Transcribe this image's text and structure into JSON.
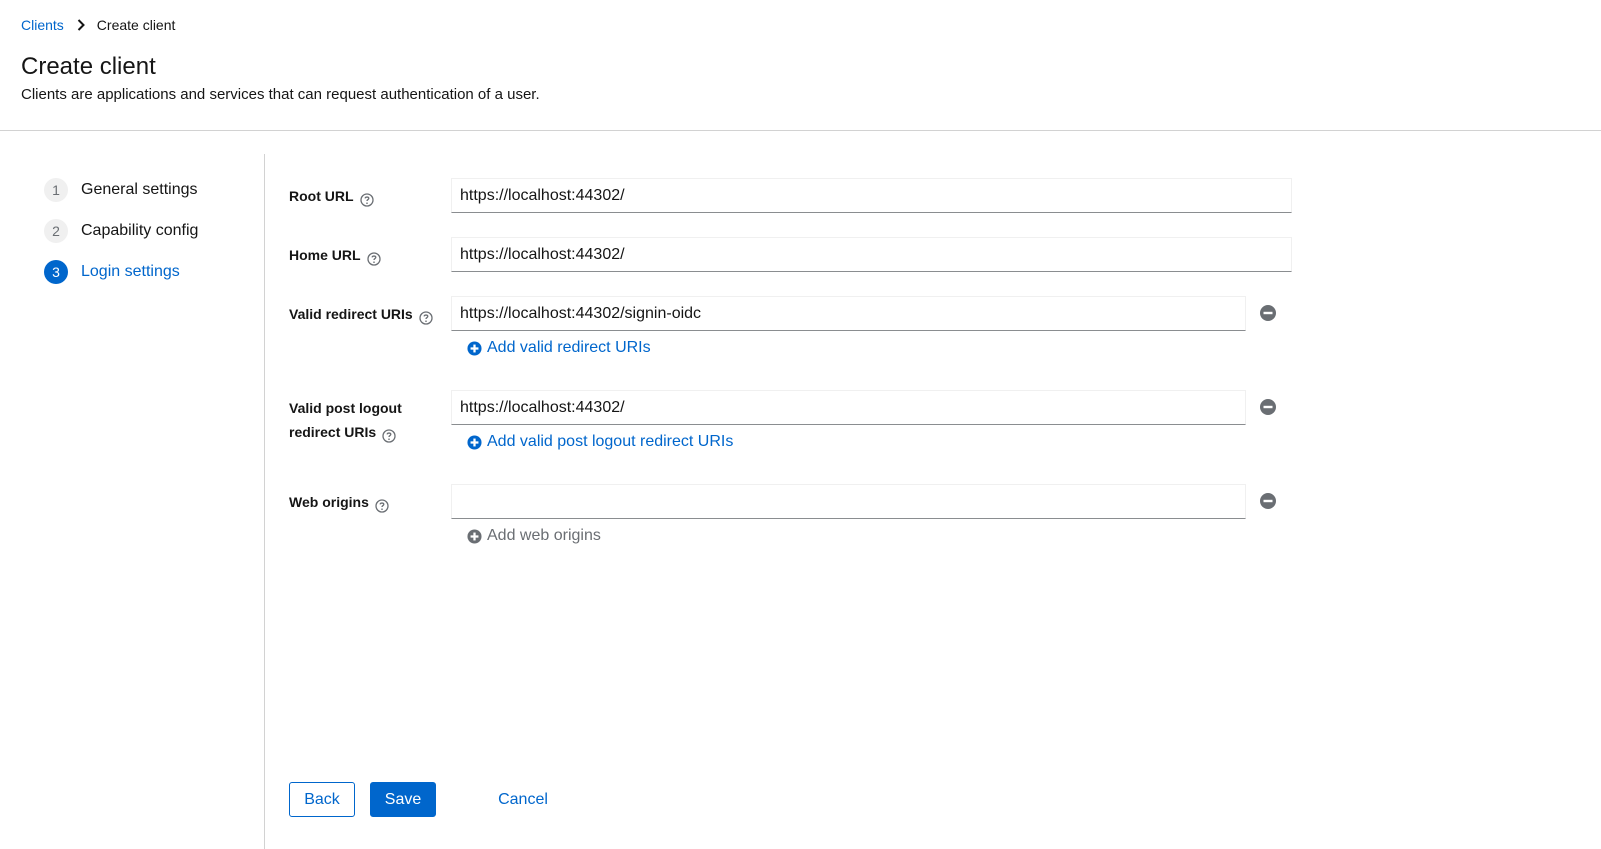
{
  "breadcrumb": {
    "parent": "Clients",
    "current": "Create client"
  },
  "header": {
    "title": "Create client",
    "description": "Clients are applications and services that can request authentication of a user."
  },
  "wizard": {
    "steps": [
      {
        "number": "1",
        "label": "General settings"
      },
      {
        "number": "2",
        "label": "Capability config"
      },
      {
        "number": "3",
        "label": "Login settings",
        "active": true
      }
    ]
  },
  "form": {
    "root_url": {
      "label": "Root URL",
      "value": "https://localhost:44302/"
    },
    "home_url": {
      "label": "Home URL",
      "value": "https://localhost:44302/"
    },
    "valid_redirect_uris": {
      "label": "Valid redirect URIs",
      "value": "https://localhost:44302/signin-oidc",
      "add_label": "Add valid redirect URIs"
    },
    "valid_post_logout": {
      "label_line1": "Valid post logout",
      "label_line2": "redirect URIs",
      "value": "https://localhost:44302/",
      "add_label": "Add valid post logout redirect URIs"
    },
    "web_origins": {
      "label": "Web origins",
      "value": "",
      "add_label": "Add web origins"
    }
  },
  "footer": {
    "back_label": "Back",
    "save_label": "Save",
    "cancel_label": "Cancel"
  },
  "colors": {
    "primary": "#0066cc",
    "border": "#d2d2d2",
    "muted": "#6a6e73"
  }
}
